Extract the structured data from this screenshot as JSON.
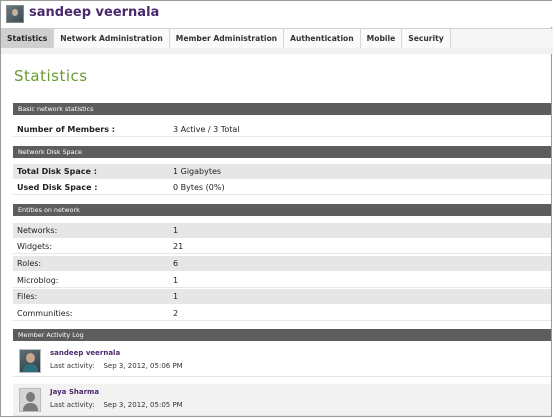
{
  "header": {
    "username": "sandeep veernala"
  },
  "tabs": [
    {
      "label": "Statistics",
      "active": true
    },
    {
      "label": "Network Administration"
    },
    {
      "label": "Member Administration"
    },
    {
      "label": "Authentication"
    },
    {
      "label": "Mobile"
    },
    {
      "label": "Security"
    }
  ],
  "page_title": "Statistics",
  "sections": {
    "basic": {
      "title": "Basic network statistics",
      "rows": [
        {
          "label": "Number of Members :",
          "value": "3 Active / 3 Total"
        }
      ]
    },
    "disk": {
      "title": "Network Disk Space",
      "rows": [
        {
          "label": "Total Disk Space :",
          "value": "1 Gigabytes"
        },
        {
          "label": "Used Disk Space :",
          "value": "0 Bytes (0%)"
        }
      ]
    },
    "entities": {
      "title": "Entities on network",
      "rows": [
        {
          "label": "Networks:",
          "value": "1"
        },
        {
          "label": "Widgets:",
          "value": "21"
        },
        {
          "label": "Roles:",
          "value": "6"
        },
        {
          "label": "Microblog:",
          "value": "1"
        },
        {
          "label": "Files:",
          "value": "1"
        },
        {
          "label": "Communities:",
          "value": "2"
        }
      ]
    },
    "activity": {
      "title": "Member Activity Log",
      "last_activity_label": "Last activity:",
      "items": [
        {
          "name": "sandeep veernala",
          "when": "Sep 3, 2012,  05:06 PM"
        },
        {
          "name": "Jaya Sharma",
          "when": "Sep 3, 2012,  05:05 PM"
        }
      ]
    }
  }
}
